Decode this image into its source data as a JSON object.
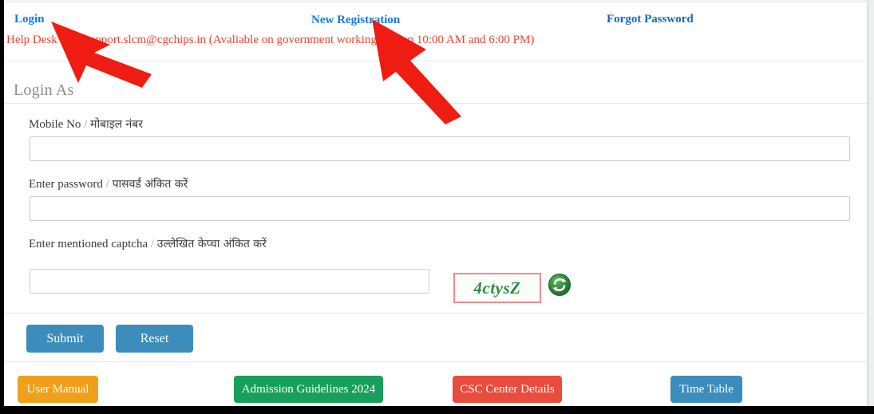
{
  "topnav": {
    "login": "Login",
    "new_registration": "New Registration",
    "forgot_password": "Forgot Password",
    "link_color": "#0d7ae5"
  },
  "helpdesk": {
    "text": "Help Desk :                 09, support.slcm@cgchips.in (Avaliable on government working          etween 10:00 AM and 6:00 PM)",
    "color": "#f4412e"
  },
  "form": {
    "heading": "Login As",
    "mobile": {
      "label_en": "Mobile No",
      "separator": "/",
      "label_hi": "मोबाइल नंबर",
      "value": "",
      "placeholder": ""
    },
    "password": {
      "label_en": "Enter password",
      "separator": "/",
      "label_hi": "पासवर्ड अंकित करें",
      "value": "",
      "placeholder": ""
    },
    "captcha": {
      "label_en": "Enter mentioned captcha",
      "separator": "/",
      "label_hi": "उल्लेखित केप्चा अंकित करें",
      "value": "",
      "placeholder": "",
      "image_text": "4ctysZ",
      "image_text_color": "#2e8b45",
      "image_border_color": "#f08a8a",
      "refresh_icon": "refresh-icon",
      "refresh_icon_color": "#2f8b3d"
    },
    "submit_label": "Submit",
    "reset_label": "Reset",
    "button_color": "#3c8dbc"
  },
  "footer": {
    "user_manual": {
      "label": "User Manual",
      "color": "#f0a11b"
    },
    "admission_guidelines": {
      "label": "Admission Guidelines 2024",
      "color": "#18a05a"
    },
    "csc_center": {
      "label": "CSC Center Details",
      "color": "#e74c3c"
    },
    "time_table": {
      "label": "Time Table",
      "color": "#3c8dbc"
    }
  },
  "annotations": {
    "arrow_color": "#ee1c12",
    "arrow_1_target": "Login",
    "arrow_2_target": "New Registration"
  }
}
